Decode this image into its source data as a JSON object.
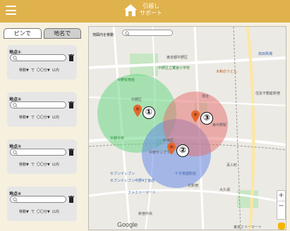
{
  "header": {
    "logo_line1": "引越し",
    "logo_line2": "サポート"
  },
  "tabs": [
    {
      "label": "ピンで"
    },
    {
      "label": "地名で"
    }
  ],
  "cards": [
    {
      "title": "地点①",
      "transport": "移動▼",
      "de": "で",
      "time": "〇〇分▼",
      "within": "以内"
    },
    {
      "title": "地点②",
      "transport": "移動▼",
      "de": "で",
      "time": "〇〇分▼",
      "within": "以内"
    },
    {
      "title": "地点③",
      "transport": "移動▼",
      "de": "で",
      "time": "〇〇分▼",
      "within": "以内"
    },
    {
      "title": "地点④",
      "transport": "移動▼",
      "de": "で",
      "time": "〇〇分▼",
      "within": "以内"
    }
  ],
  "map": {
    "search_label": "地図内を移動",
    "google": "Google",
    "pin_numbers": [
      "①",
      "②",
      "③"
    ],
    "places": [
      "中野区立鷺宮小学校",
      "大和のうどん",
      "高田馬場",
      "東京都中野区",
      "中野区",
      "落合",
      "中野中学",
      "中野サンプラザ",
      "中央区",
      "ファミリーマート",
      "セブンイレブン",
      "北新宿",
      "百人町",
      "大久保",
      "新宿中央",
      "東京ミリーマート",
      "東中野駅",
      "住友不動産新宿",
      "セブンイレブン中野4丁目店",
      "ゲオ荒屋町店",
      "中野体育館"
    ],
    "zoom_in": "+",
    "zoom_out": "−",
    "circle_colors": [
      "#5fd57d",
      "#5b82e6",
      "#e66c6c"
    ]
  }
}
